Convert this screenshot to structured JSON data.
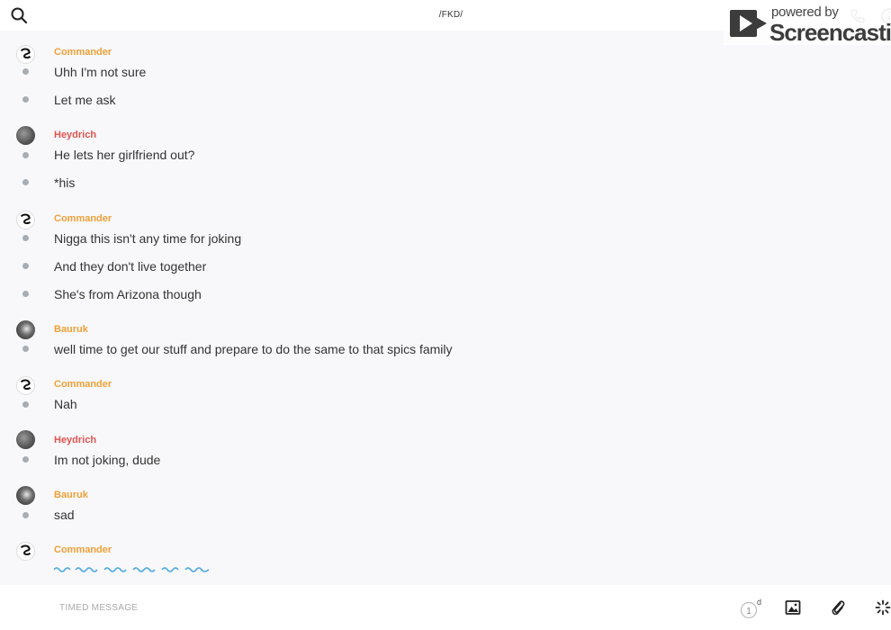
{
  "header": {
    "channel_title": "/FKD/",
    "search_icon": "search-icon",
    "phone_icon": "phone-icon",
    "info_icon": "info-icon"
  },
  "watermark": {
    "line1": "powered by",
    "line2": "Screencastify"
  },
  "messages": {
    "group0": {
      "sender": "Commander",
      "lines": [
        "Uhh I'm not sure",
        "Let me ask"
      ]
    },
    "group1": {
      "sender": "Heydrich",
      "lines": [
        "He lets her girlfriend out?",
        "*his"
      ]
    },
    "group2": {
      "sender": "Commander",
      "lines": [
        "Nigga this isn't any time for joking",
        "And they don't live together",
        "She's from Arizona though"
      ]
    },
    "group3": {
      "sender": "Bauruk",
      "lines": [
        "well time to get our stuff and prepare to do the same to that spics family"
      ]
    },
    "group4": {
      "sender": "Commander",
      "lines": [
        "Nah"
      ]
    },
    "group5": {
      "sender": "Heydrich",
      "lines": [
        "Im not joking, dude"
      ]
    },
    "group6": {
      "sender": "Bauruk",
      "lines": [
        "sad"
      ]
    },
    "group7": {
      "sender": "Commander",
      "lines": []
    }
  },
  "composer": {
    "placeholder": "TIMED MESSAGE",
    "timer_value": "1",
    "timer_unit": "d"
  },
  "colors": {
    "orange_sender": "#f0a038",
    "red_sender": "#e0534e",
    "typing_squiggle": "#4aa8e0",
    "background": "#f8f8fa"
  }
}
